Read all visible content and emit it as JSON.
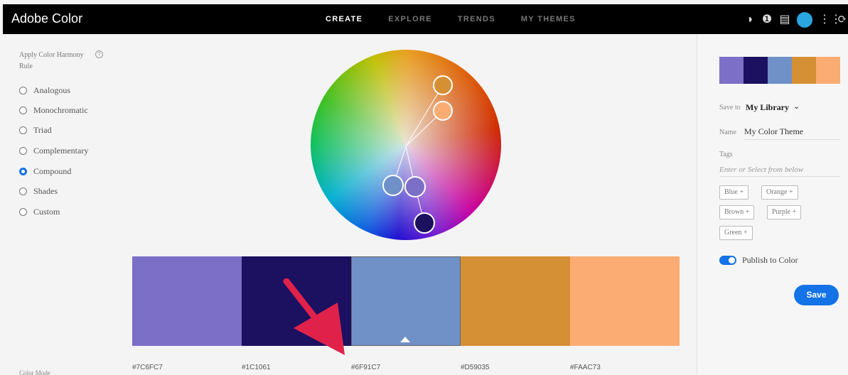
{
  "app": {
    "title": "Adobe Color"
  },
  "nav": {
    "tabs": [
      "CREATE",
      "EXPLORE",
      "TRENDS",
      "MY THEMES"
    ],
    "active": "CREATE"
  },
  "top_icons": [
    "contrast-icon",
    "help-icon",
    "chat-icon",
    "avatar",
    "grid-icon",
    "creative-cloud-icon"
  ],
  "left_panel": {
    "harmony_label": "Apply Color Harmony Rule",
    "rules": [
      "Analogous",
      "Monochromatic",
      "Triad",
      "Complementary",
      "Compound",
      "Shades",
      "Custom"
    ],
    "selected_rule": "Compound",
    "color_mode_label": "Color Mode"
  },
  "colors": [
    {
      "hex": "#7C6FC7",
      "label": "#7C6FC7"
    },
    {
      "hex": "#1C1061",
      "label": "#1C1061"
    },
    {
      "hex": "#6F91C7",
      "label": "#6F91C7"
    },
    {
      "hex": "#D59035",
      "label": "#D59035"
    },
    {
      "hex": "#FAAC73",
      "label": "#FAAC73"
    }
  ],
  "selected_swatch": 2,
  "right_panel": {
    "save_to_label": "Save to",
    "save_to_value": "My Library",
    "name_label": "Name",
    "name_value": "My Color Theme",
    "tags_label": "Tags",
    "tags_placeholder": "Enter or Select from below",
    "tags": [
      "Blue",
      "Orange",
      "Brown",
      "Purple",
      "Green"
    ],
    "publish_label": "Publish to Color",
    "publish_on": true,
    "save_button": "Save"
  },
  "accent_color": "#1473E6",
  "annotation_arrow_color": "#E0224A"
}
